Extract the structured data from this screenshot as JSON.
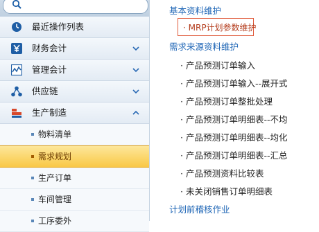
{
  "search": {
    "placeholder": ""
  },
  "sidebar": {
    "items": [
      {
        "label": "最近操作列表",
        "icon": "clock-icon",
        "has_chevron": false
      },
      {
        "label": "财务会计",
        "icon": "yen-icon",
        "has_chevron": true,
        "chevron": "down"
      },
      {
        "label": "管理会计",
        "icon": "chart-icon",
        "has_chevron": true,
        "chevron": "down"
      },
      {
        "label": "供应链",
        "icon": "network-icon",
        "has_chevron": true,
        "chevron": "down"
      },
      {
        "label": "生产制造",
        "icon": "factory-icon",
        "has_chevron": true,
        "chevron": "up"
      }
    ],
    "sub_items": [
      {
        "label": "物料清单"
      },
      {
        "label": "需求规划",
        "active": true
      },
      {
        "label": "生产订单"
      },
      {
        "label": "车间管理"
      },
      {
        "label": "工序委外"
      }
    ]
  },
  "content": {
    "section1": "基本资料维护",
    "mrp_link": "· MRP计划参数维护",
    "section2": "需求来源资料维护",
    "links": [
      "· 产品预测订单输入",
      "· 产品预测订单输入--展开式",
      "· 产品预测订单整批处理",
      "· 产品预测订单明细表--不均",
      "· 产品预测订单明细表--均化",
      "· 产品预测订单明细表--汇总",
      "· 产品预测资料比较表",
      "· 未关闭销售订单明细表"
    ],
    "section3": "计划前稽核作业"
  },
  "colors": {
    "section_title": "#1c64b5",
    "active_bg": "#f9c846",
    "highlight_border": "#e05a3a",
    "sidebar_bg": "#e8eef5"
  }
}
